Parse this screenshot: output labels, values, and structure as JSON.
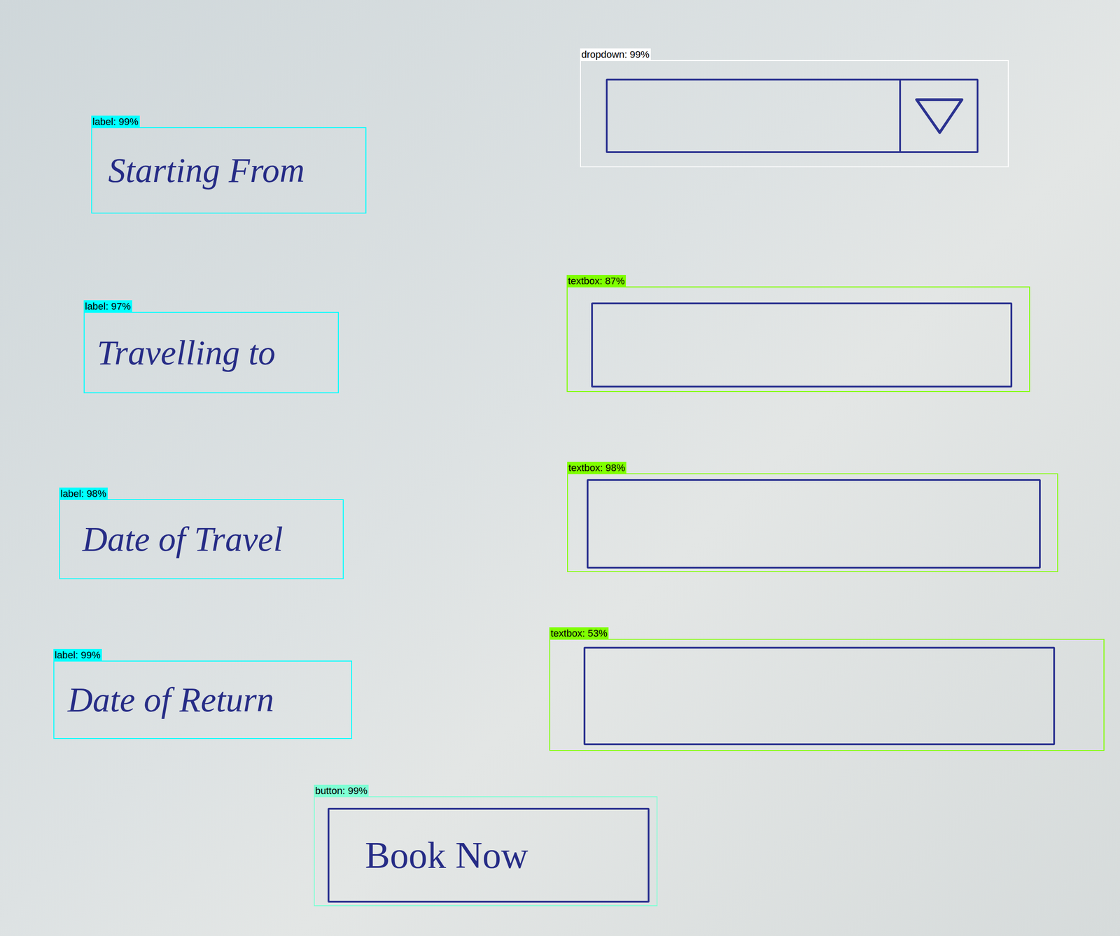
{
  "detections": [
    {
      "kind": "dropdown",
      "tag": "dropdown: 99%",
      "text": "",
      "color": "#ffffff"
    },
    {
      "kind": "label",
      "tag": "label: 99%",
      "text": "Starting From",
      "color": "#00ffff"
    },
    {
      "kind": "textbox",
      "tag": "textbox: 87%",
      "text": "",
      "color": "#7fff00"
    },
    {
      "kind": "label",
      "tag": "label: 97%",
      "text": "Travelling to",
      "color": "#00ffff"
    },
    {
      "kind": "textbox",
      "tag": "textbox: 98%",
      "text": "",
      "color": "#7fff00"
    },
    {
      "kind": "label",
      "tag": "label: 98%",
      "text": "Date of Travel",
      "color": "#00ffff"
    },
    {
      "kind": "textbox",
      "tag": "textbox: 53%",
      "text": "",
      "color": "#7fff00"
    },
    {
      "kind": "label",
      "tag": "label: 99%",
      "text": "Date of Return",
      "color": "#00ffff"
    },
    {
      "kind": "button",
      "tag": "button: 99%",
      "text": "Book Now",
      "color": "#7fffd4"
    }
  ]
}
